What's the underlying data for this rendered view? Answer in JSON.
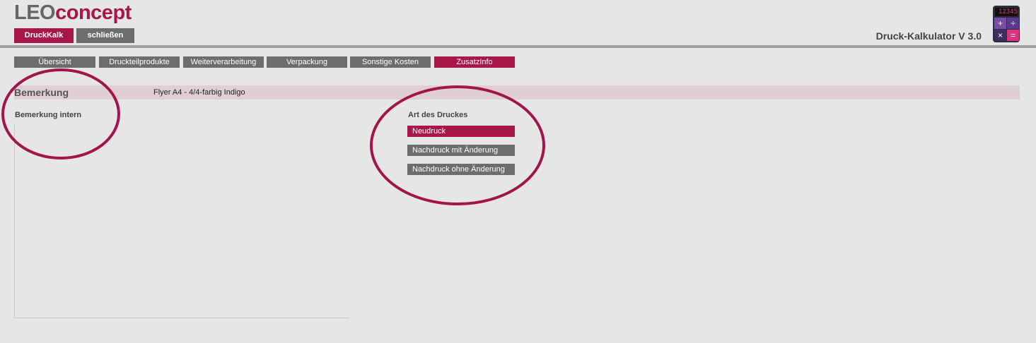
{
  "logo": {
    "part1": "LEO",
    "part2": "concept"
  },
  "header": {
    "btn_druckkalk": "DruckKalk",
    "btn_schliessen": "schließen",
    "app_title": "Druck-Kalkulator V 3.0",
    "calc_display": "12345"
  },
  "tabs": [
    "Übersicht",
    "Druckteilprodukte",
    "Weiterverarbeitung",
    "Verpackung",
    "Sonstige Kosten",
    "ZusatzInfo"
  ],
  "active_tab": "ZusatzInfo",
  "bemerkung": {
    "label": "Bemerkung",
    "value": "Flyer A4 - 4/4-farbig Indigo"
  },
  "bemerkung_intern": {
    "label": "Bemerkung intern",
    "value": ""
  },
  "art_des_druckes": {
    "label": "Art des Druckes",
    "options": [
      "Neudruck",
      "Nachdruck mit Änderung",
      "Nachdruck ohne Änderung"
    ],
    "selected": "Neudruck"
  },
  "colors": {
    "accent": "#a8174a",
    "button_gray": "#6d6d6d",
    "background": "#e6e6e6",
    "highlight_band": "#dfcfd3"
  }
}
